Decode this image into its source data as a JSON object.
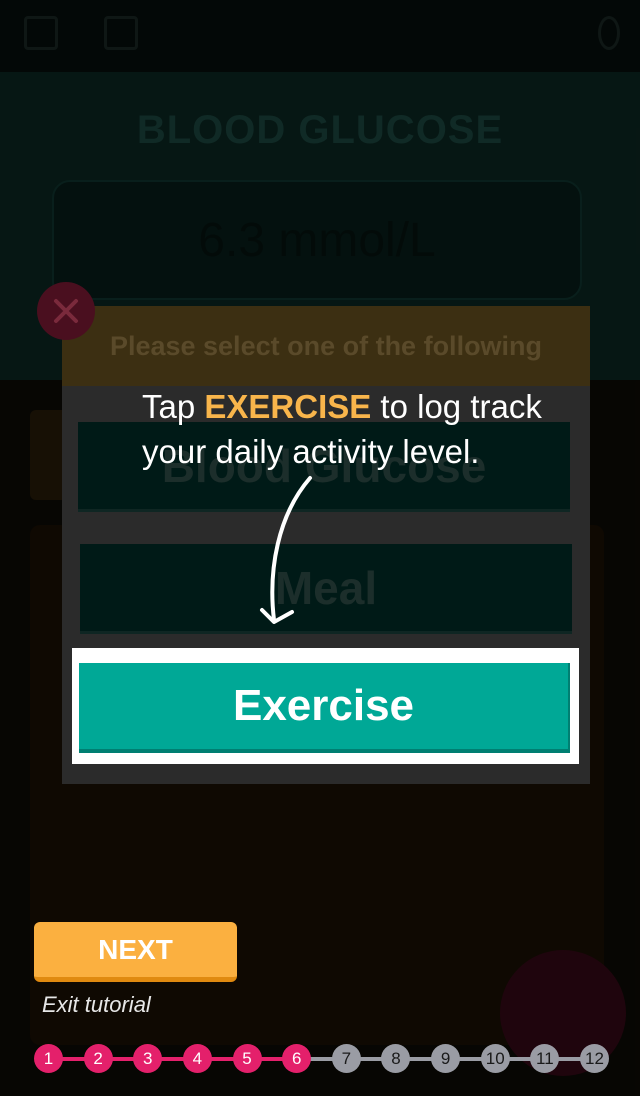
{
  "background": {
    "heading": "BLOOD GLUCOSE",
    "reading": "6.3 mmol/L"
  },
  "dialog": {
    "header": "Please select one of the following",
    "options": [
      "Blood Glucose",
      "Meal",
      "Exercise"
    ]
  },
  "tooltip": {
    "prefix": "Tap ",
    "keyword": "EXERCISE",
    "suffix": " to log track your daily activity level."
  },
  "controls": {
    "next_label": "NEXT",
    "exit_label": "Exit tutorial"
  },
  "progress": {
    "steps": [
      "1",
      "2",
      "3",
      "4",
      "5",
      "6",
      "7",
      "8",
      "9",
      "10",
      "11",
      "12"
    ],
    "current_step": 6
  },
  "colors": {
    "accent": "#00a896",
    "highlight_text": "#f8b54b",
    "next_button": "#fbb040",
    "step_done": "#e4206b",
    "step_todo": "#9a9ca4"
  }
}
